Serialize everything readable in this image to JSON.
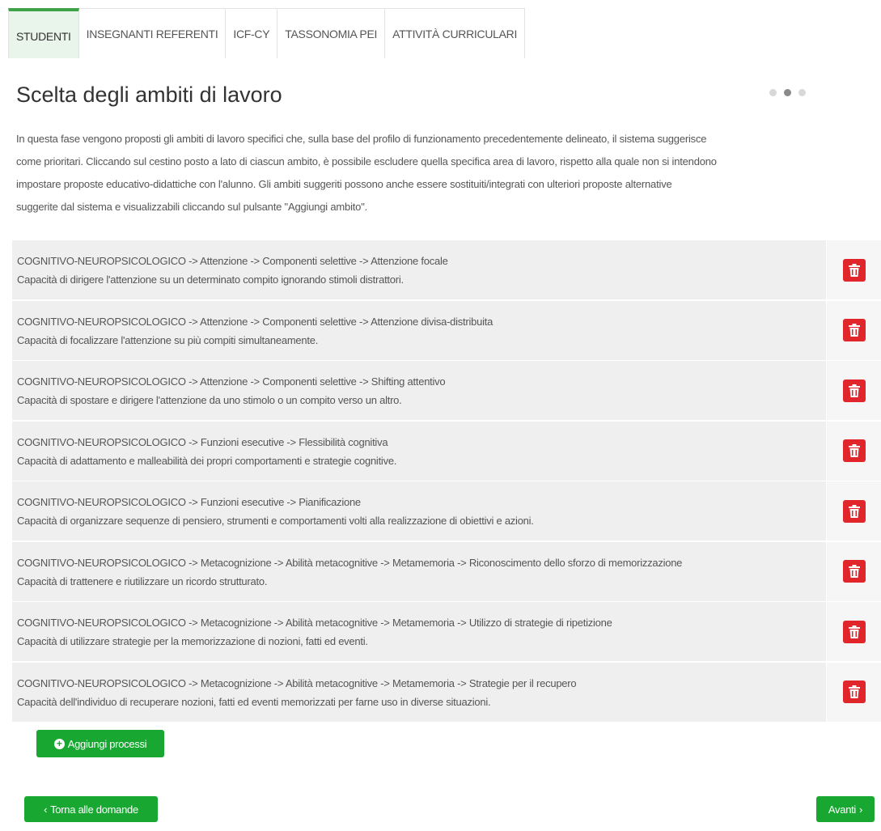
{
  "tabs": [
    {
      "label": "STUDENTI",
      "active": true
    },
    {
      "label": "INSEGNANTI REFERENTI",
      "active": false
    },
    {
      "label": "ICF-CY",
      "active": false
    },
    {
      "label": "TASSONOMIA PEI",
      "active": false
    },
    {
      "label": "ATTIVITÀ CURRICULARI",
      "active": false
    }
  ],
  "header": {
    "title": "Scelta degli ambiti di lavoro",
    "step_current": 2,
    "step_total": 3
  },
  "intro": {
    "line1": "In questa fase vengono proposti gli ambiti di lavoro specifici che, sulla base del profilo di funzionamento precedentemente delineato, il sistema suggerisce",
    "line2": "come prioritari. Cliccando sul cestino posto a lato di ciascun ambito, è possibile escludere quella specifica area di lavoro, rispetto alla quale non si intendono",
    "line3": "impostare proposte educativo-didattiche con l'alunno. Gli ambiti suggeriti possono anche essere sostituiti/integrati con ulteriori proposte alternative",
    "line4": "suggerite dal sistema e visualizzabili cliccando sul pulsante \"Aggiungi ambito\"."
  },
  "items": [
    {
      "path": "COGNITIVO-NEUROPSICOLOGICO -> Attenzione -> Componenti selettive -> Attenzione focale",
      "desc": "Capacità di dirigere l'attenzione su un determinato compito ignorando stimoli distrattori."
    },
    {
      "path": "COGNITIVO-NEUROPSICOLOGICO -> Attenzione -> Componenti selettive -> Attenzione divisa-distribuita",
      "desc": "Capacità di focalizzare l'attenzione su più compiti simultaneamente."
    },
    {
      "path": "COGNITIVO-NEUROPSICOLOGICO -> Attenzione -> Componenti selettive -> Shifting attentivo",
      "desc": "Capacità di spostare e dirigere l'attenzione da uno stimolo o un compito verso un altro."
    },
    {
      "path": "COGNITIVO-NEUROPSICOLOGICO -> Funzioni esecutive -> Flessibilità cognitiva",
      "desc": "Capacità di adattamento e malleabilità dei propri comportamenti e strategie cognitive."
    },
    {
      "path": "COGNITIVO-NEUROPSICOLOGICO -> Funzioni esecutive -> Pianificazione",
      "desc": "Capacità di organizzare sequenze di pensiero, strumenti e comportamenti volti alla realizzazione di obiettivi e azioni."
    },
    {
      "path": "COGNITIVO-NEUROPSICOLOGICO -> Metacognizione -> Abilità metacognitive -> Metamemoria -> Riconoscimento dello sforzo di memorizzazione",
      "desc": "Capacità di trattenere e riutilizzare un ricordo strutturato."
    },
    {
      "path": "COGNITIVO-NEUROPSICOLOGICO -> Metacognizione -> Abilità metacognitive -> Metamemoria -> Utilizzo di strategie di ripetizione",
      "desc": "Capacità di utilizzare strategie per la memorizzazione di nozioni, fatti ed eventi."
    },
    {
      "path": "COGNITIVO-NEUROPSICOLOGICO -> Metacognizione -> Abilità metacognitive -> Metamemoria -> Strategie per il recupero",
      "desc": "Capacità dell'individuo di recuperare nozioni, fatti ed eventi memorizzati per farne uso in diverse situazioni."
    }
  ],
  "buttons": {
    "add_label": "Aggiungi processi",
    "back_label": "Torna alle domande",
    "next_label": "Avanti"
  },
  "colors": {
    "accent_green": "#18a832",
    "tab_active_border": "#3fa34a",
    "delete_red": "#e0262a"
  }
}
